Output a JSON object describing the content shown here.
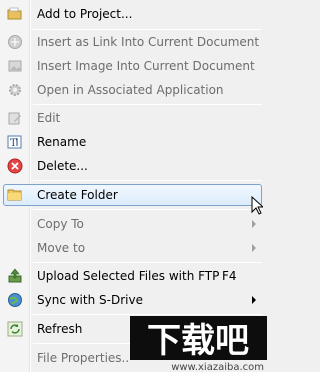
{
  "menu": {
    "items": [
      {
        "label": "Add to Project...",
        "icon": "folder-plus-icon",
        "disabled": false
      },
      {
        "label": "Insert as Link Into Current Document",
        "icon": "link-icon",
        "disabled": true
      },
      {
        "label": "Insert Image Into Current Document",
        "icon": "image-icon",
        "disabled": true
      },
      {
        "label": "Open in Associated Application",
        "icon": "gear-icon",
        "disabled": true
      },
      {
        "label": "Edit",
        "icon": "edit-icon",
        "disabled": true
      },
      {
        "label": "Rename",
        "icon": "rename-icon",
        "disabled": false
      },
      {
        "label": "Delete...",
        "icon": "delete-icon",
        "disabled": false
      },
      {
        "label": "Create Folder",
        "icon": "folder-icon",
        "disabled": false
      },
      {
        "label": "Copy To",
        "icon": "",
        "disabled": true
      },
      {
        "label": "Move to",
        "icon": "",
        "disabled": true
      },
      {
        "label": "Upload Selected Files with FTP",
        "icon": "upload-icon",
        "disabled": false,
        "shortcut": "F4"
      },
      {
        "label": "Sync with S-Drive",
        "icon": "globe-icon",
        "disabled": false
      },
      {
        "label": "Refresh",
        "icon": "refresh-icon",
        "disabled": false
      },
      {
        "label": "File Properties...",
        "icon": "",
        "disabled": true
      }
    ]
  },
  "watermark": {
    "text": "www.xiazaiba.com",
    "glyphs": "下载吧"
  },
  "colors": {
    "highlight_border": "#7da2ce",
    "highlight_top": "#f1f8fe",
    "highlight_bottom": "#dcecfc",
    "disabled_text": "#6d6d6d"
  }
}
